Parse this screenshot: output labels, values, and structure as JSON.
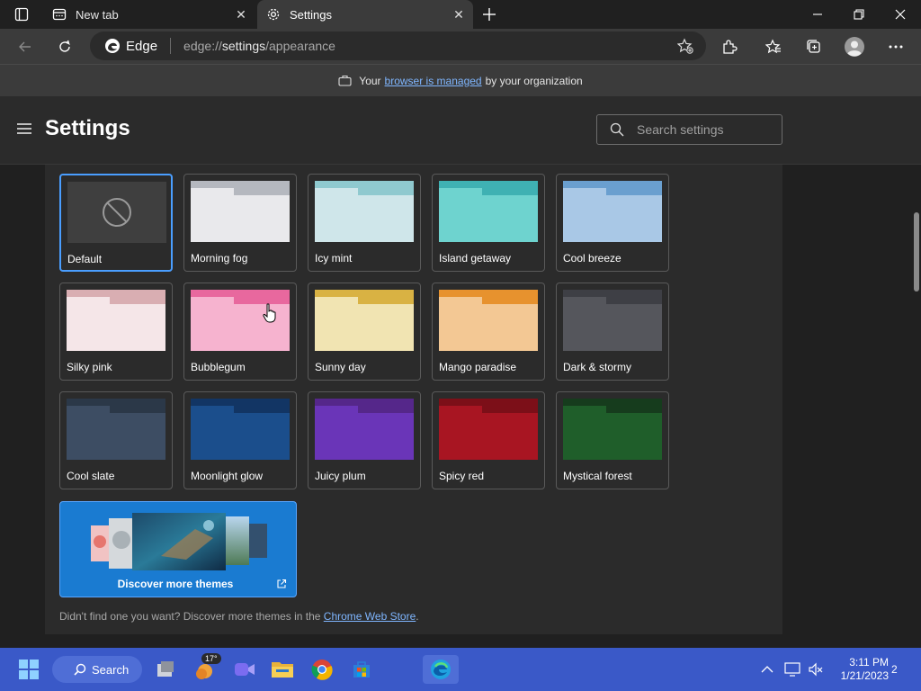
{
  "browser": {
    "tabs": [
      {
        "title": "New tab",
        "icon": "new-tab-icon",
        "active": false
      },
      {
        "title": "Settings",
        "icon": "gear-icon",
        "active": true
      }
    ],
    "address": {
      "brand": "Edge",
      "scheme": "edge://",
      "host": "settings",
      "path": "/appearance"
    }
  },
  "infobar": {
    "prefix": "Your",
    "link": "browser is managed",
    "suffix": "by your organization"
  },
  "settings": {
    "title": "Settings",
    "search_placeholder": "Search settings"
  },
  "themes": [
    {
      "name": "Default",
      "selected": true,
      "back": "#3f3f3f",
      "tab": "#3f3f3f",
      "front": "#3f3f3f",
      "none": true
    },
    {
      "name": "Morning fog",
      "back": "#b5b8bf",
      "tab": "#e9e9ec",
      "front": "#e9e9ec"
    },
    {
      "name": "Icy mint",
      "back": "#8fc9cf",
      "tab": "#cfe6ea",
      "front": "#cfe6ea"
    },
    {
      "name": "Island getaway",
      "back": "#3fb1b3",
      "tab": "#6ed3cf",
      "front": "#6ed3cf"
    },
    {
      "name": "Cool breeze",
      "back": "#6a9fcf",
      "tab": "#a9c8e6",
      "front": "#a9c8e6"
    },
    {
      "name": "Silky pink",
      "back": "#d9aeb2",
      "tab": "#f5e6e8",
      "front": "#f5e6e8"
    },
    {
      "name": "Bubblegum",
      "back": "#e8689e",
      "tab": "#f6b3cf",
      "front": "#f6b3cf"
    },
    {
      "name": "Sunny day",
      "back": "#d9b243",
      "tab": "#f1e4b2",
      "front": "#f1e4b2"
    },
    {
      "name": "Mango paradise",
      "back": "#e7922e",
      "tab": "#f3c894",
      "front": "#f3c894"
    },
    {
      "name": "Dark & stormy",
      "back": "#3e3f45",
      "tab": "#55565c",
      "front": "#55565c"
    },
    {
      "name": "Cool slate",
      "back": "#2b3848",
      "tab": "#3d4d63",
      "front": "#3d4d63"
    },
    {
      "name": "Moonlight glow",
      "back": "#123564",
      "tab": "#1b4e8c",
      "front": "#1b4e8c"
    },
    {
      "name": "Juicy plum",
      "back": "#55278a",
      "tab": "#6a35b8",
      "front": "#6a35b8"
    },
    {
      "name": "Spicy red",
      "back": "#7c0f18",
      "tab": "#a81522",
      "front": "#a81522"
    },
    {
      "name": "Mystical forest",
      "back": "#163c1d",
      "tab": "#1f5e2a",
      "front": "#1f5e2a"
    }
  ],
  "discover": {
    "label": "Discover more themes"
  },
  "footnote": {
    "text": "Didn't find one you want? Discover more themes in the",
    "link": "Chrome Web Store",
    "end": "."
  },
  "taskbar": {
    "search_label": "Search",
    "weather_badge": "17°",
    "time": "3:11 PM",
    "date": "1/21/2023",
    "notification_count": "2"
  },
  "colors": {
    "accent": "#4a9eff",
    "taskbar": "#3a59c8",
    "link": "#7fb6ff"
  }
}
